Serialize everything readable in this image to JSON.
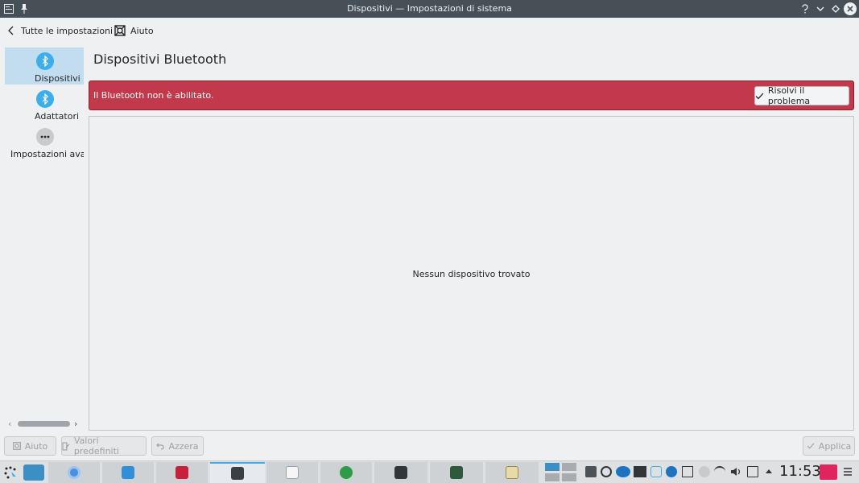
{
  "window": {
    "title": "Dispositivi — Impostazioni di sistema"
  },
  "toolbar": {
    "back_label": "Tutte le impostazioni",
    "help_label": "Aiuto"
  },
  "sidebar": {
    "items": [
      {
        "label": "Dispositivi",
        "icon": "bluetooth-icon",
        "active": true
      },
      {
        "label": "Adattatori",
        "icon": "bluetooth-icon",
        "active": false
      },
      {
        "label": "Impostazioni avanzate",
        "icon": "more-icon",
        "active": false
      }
    ]
  },
  "main": {
    "title": "Dispositivi Bluetooth",
    "alert_message": "Il Bluetooth non è abilitato.",
    "fix_button_label": "Risolvi il problema",
    "empty_message": "Nessun dispositivo trovato"
  },
  "bottom_bar": {
    "help_label": "Aiuto",
    "defaults_label": "Valori predefiniti",
    "reset_label": "Azzera",
    "apply_label": "Applica"
  },
  "taskbar": {
    "clock": "11:53"
  },
  "colors": {
    "titlebar": "#475057",
    "accent": "#3daee9",
    "selection": "#c2dcf0",
    "alert": "#c1394a",
    "window_bg": "#eff0f1"
  }
}
